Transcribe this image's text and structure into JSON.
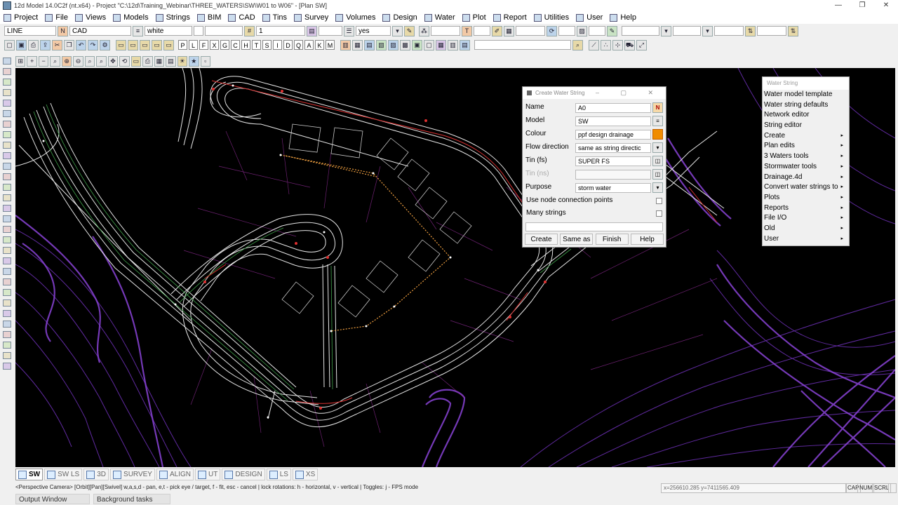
{
  "window": {
    "title": "12d Model  14.0C2f (nt.x64) - Project \"C:\\12d\\Training_Webinar\\THREE_WATERS\\SW\\W01 to W06\" - [Plan SW]",
    "controls": [
      "—",
      "❐",
      "✕"
    ]
  },
  "menubar": [
    "Project",
    "File",
    "Views",
    "Models",
    "Strings",
    "BIM",
    "CAD",
    "Tins",
    "Survey",
    "Volumes",
    "Design",
    "Water",
    "Plot",
    "Report",
    "Utilities",
    "User",
    "Help"
  ],
  "toolbar1": {
    "string_type": "LINE",
    "model": "CAD",
    "colour": "white",
    "weight": "1",
    "visible": "yes"
  },
  "toolbar2_letters": [
    "P",
    "L",
    "F",
    "X",
    "G",
    "C",
    "H",
    "T",
    "S",
    "I",
    "D",
    "Q",
    "A",
    "K",
    "M"
  ],
  "view_tabs": [
    {
      "label": "SW",
      "active": true
    },
    {
      "label": "SW LS",
      "active": false
    },
    {
      "label": "3D",
      "active": false
    },
    {
      "label": "SURVEY",
      "active": false
    },
    {
      "label": "ALIGN",
      "active": false
    },
    {
      "label": "UT",
      "active": false
    },
    {
      "label": "DESIGN",
      "active": false
    },
    {
      "label": "LS",
      "active": false
    },
    {
      "label": "XS",
      "active": false
    }
  ],
  "status": {
    "message": "<Perspective Camera> [Orbit][Pan][Swivel] w,a,s,d - pan, e,t - pick eye / target, f - fit, esc - cancel | lock rotations: h - horizontal, v - vertical | Toggles: j - FPS mode",
    "coords": "x=256610.285 y=7411565.409",
    "caps": "CAP",
    "num": "NUM",
    "scrl": "SCRL"
  },
  "bottom_tabs": [
    "Output Window",
    "Background tasks"
  ],
  "dialog": {
    "title": "Create Water String",
    "fields": [
      {
        "label": "Name",
        "value": "A0",
        "button": "N",
        "disabled": false
      },
      {
        "label": "Model",
        "value": "SW",
        "button": "list",
        "disabled": false
      },
      {
        "label": "Colour",
        "value": "ppf design drainage",
        "button": "orange",
        "disabled": false
      },
      {
        "label": "Flow direction",
        "value": "same as string directic",
        "button": "drop",
        "disabled": false
      },
      {
        "label": "Tin (fs)",
        "value": "SUPER FS",
        "button": "tin",
        "disabled": false
      },
      {
        "label": "Tin (ns)",
        "value": "",
        "button": "tin",
        "disabled": true
      },
      {
        "label": "Purpose",
        "value": "storm water",
        "button": "drop",
        "disabled": false
      }
    ],
    "checkboxes": [
      {
        "label": "Use node connection points",
        "checked": false
      },
      {
        "label": "Many strings",
        "checked": false
      }
    ],
    "buttons": [
      "Create",
      "Same as",
      "Finish",
      "Help"
    ]
  },
  "water_menu": {
    "title": "Water String",
    "items": [
      {
        "label": "Water model template",
        "submenu": false
      },
      {
        "label": "Water string defaults",
        "submenu": false
      },
      {
        "label": "Network editor",
        "submenu": false
      },
      {
        "label": "String editor",
        "submenu": false
      },
      {
        "label": "Create",
        "submenu": true
      },
      {
        "label": "Plan edits",
        "submenu": true
      },
      {
        "label": "3 Waters tools",
        "submenu": true
      },
      {
        "label": "Stormwater tools",
        "submenu": true
      },
      {
        "label": "Drainage.4d",
        "submenu": true
      },
      {
        "label": "Convert water strings to",
        "submenu": true
      },
      {
        "label": "Plots",
        "submenu": true
      },
      {
        "label": "Reports",
        "submenu": true
      },
      {
        "label": "File I/O",
        "submenu": true
      },
      {
        "label": "Old",
        "submenu": true
      },
      {
        "label": "User",
        "submenu": true
      }
    ]
  },
  "colors": {
    "canvas": "#000000",
    "road_lines": "#e8e8e8",
    "contour_purple": "#7a3fc4",
    "water_orange": "#f08c00",
    "design_red": "#d83030"
  }
}
